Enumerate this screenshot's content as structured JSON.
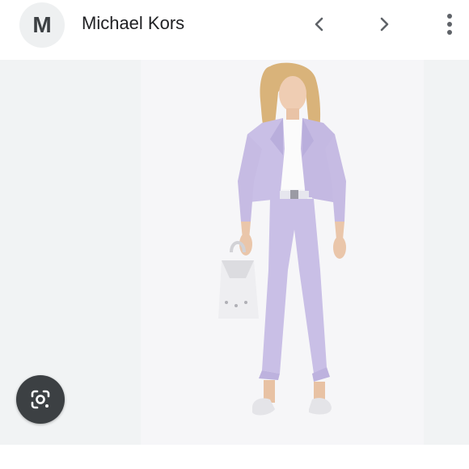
{
  "header": {
    "avatar_letter": "M",
    "source_name": "Michael Kors"
  },
  "icons": {
    "prev": "chevron-left-icon",
    "next": "chevron-right-icon",
    "more": "more-vert-icon",
    "lens": "google-lens-icon"
  },
  "colors": {
    "outfit_lavender": "#c9bfe6",
    "lens_button": "#3c4043",
    "image_backdrop": "#f1f3f4"
  }
}
